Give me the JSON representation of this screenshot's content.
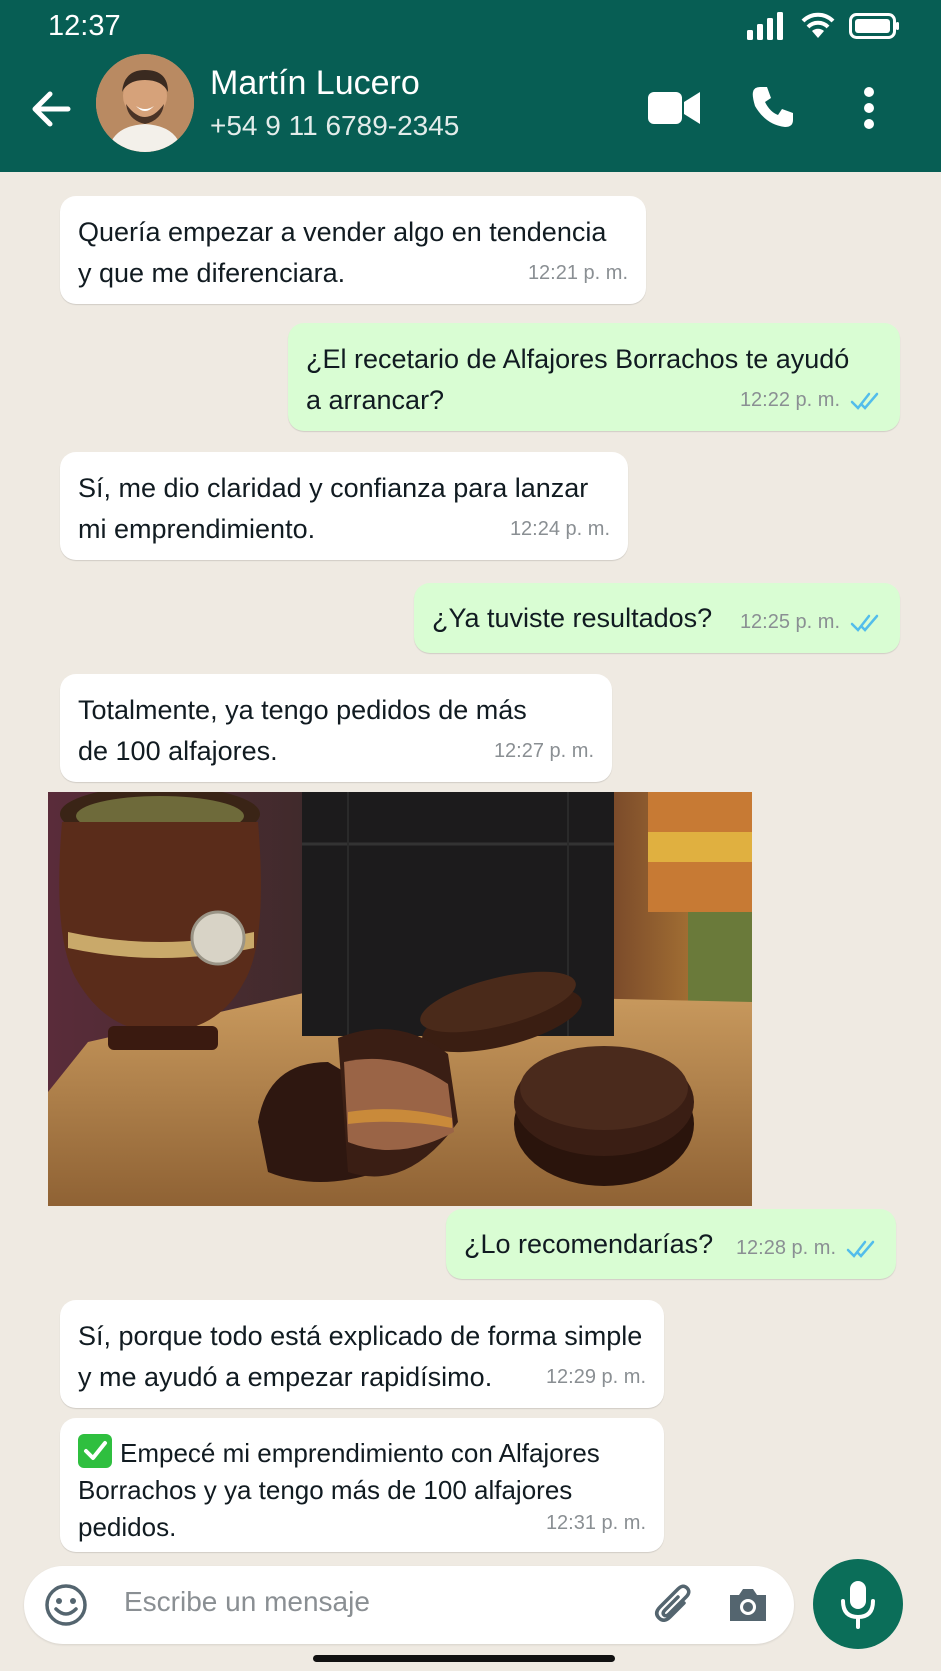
{
  "status_bar": {
    "time": "12:37"
  },
  "contact": {
    "name": "Martín Lucero",
    "phone": "+54 9 11 6789-2345"
  },
  "messages": [
    {
      "dir": "in",
      "lines": [
        "Quería empezar a vender algo en tendencia",
        "y que me diferenciara."
      ],
      "time": "12:21 p. m."
    },
    {
      "dir": "out",
      "lines": [
        "¿El recetario de Alfajores Borrachos te ayudó",
        "a arrancar?"
      ],
      "time": "12:22 p. m."
    },
    {
      "dir": "in",
      "lines": [
        "Sí, me dio claridad y confianza para lanzar",
        "mi emprendimiento."
      ],
      "time": "12:24 p. m."
    },
    {
      "dir": "out",
      "lines": [
        "¿Ya tuviste resultados?"
      ],
      "time": "12:25 p. m."
    },
    {
      "dir": "in",
      "lines": [
        "Totalmente, ya tengo pedidos de más",
        "de 100 alfajores."
      ],
      "time": "12:27 p. m."
    },
    {
      "dir": "out",
      "lines": [
        "¿Lo recomendarías?"
      ],
      "time": "12:28 p. m."
    },
    {
      "dir": "in",
      "lines": [
        "Sí, porque todo está explicado de forma simple",
        "y me ayudó a empezar rapidísimo."
      ],
      "time": "12:29 p. m."
    },
    {
      "dir": "in",
      "lines": [
        "Empecé mi emprendimiento con Alfajores",
        "Borrachos y ya tengo más de 100 alfajores",
        "pedidos."
      ],
      "time": "12:31 p. m."
    }
  ],
  "composer": {
    "placeholder": "Escribe un mensaje"
  },
  "colors": {
    "header": "#075e54",
    "outgoing": "#d9fdd3",
    "incoming": "#ffffff",
    "read_ticks": "#53bdeb",
    "mic": "#0b6e59"
  }
}
